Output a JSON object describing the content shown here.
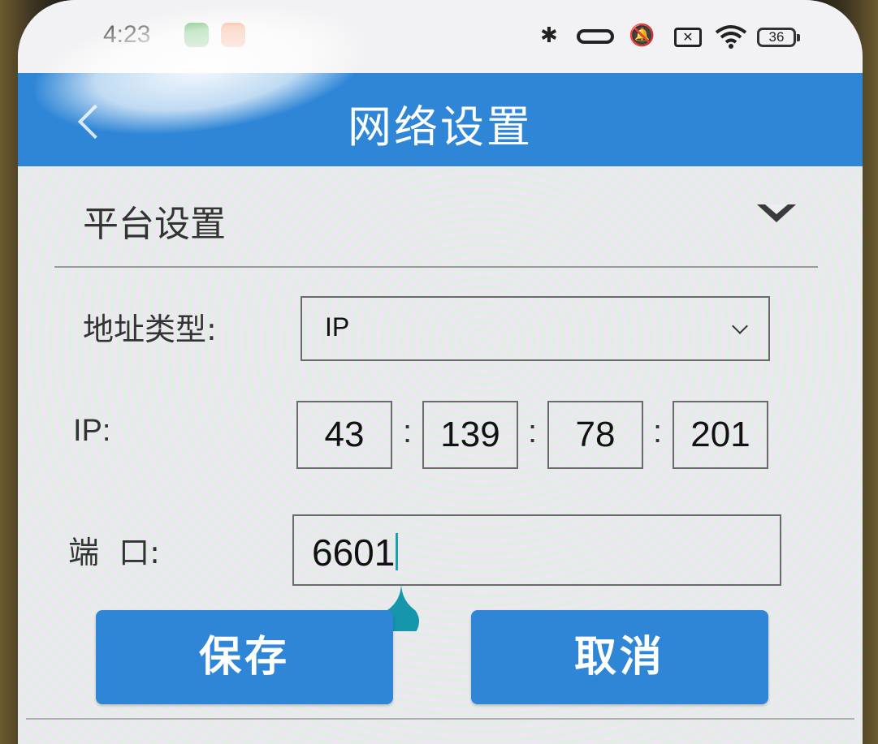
{
  "status_bar": {
    "time": "4:23",
    "battery": "36",
    "icons": [
      "app-notification-icon",
      "app-notification-icon",
      "bluetooth-icon",
      "vibrate-icon",
      "mute-icon",
      "no-sim-icon",
      "wifi-icon",
      "battery-icon"
    ]
  },
  "header": {
    "title": "网络设置",
    "back_icon": "back-arrow-icon",
    "background": "#2f86d6"
  },
  "section": {
    "title": "平台设置",
    "toggle_icon": "chevron-down-icon"
  },
  "form": {
    "address_type": {
      "label": "地址类型:",
      "value": "IP",
      "icon": "dropdown-caret-icon"
    },
    "ip": {
      "label": "IP:",
      "octets": [
        "43",
        "139",
        "78",
        "201"
      ],
      "separator": ":"
    },
    "port": {
      "label": "端  口:",
      "value": "6601"
    }
  },
  "buttons": {
    "save": "保存",
    "cancel": "取消",
    "color": "#2f86d6"
  }
}
